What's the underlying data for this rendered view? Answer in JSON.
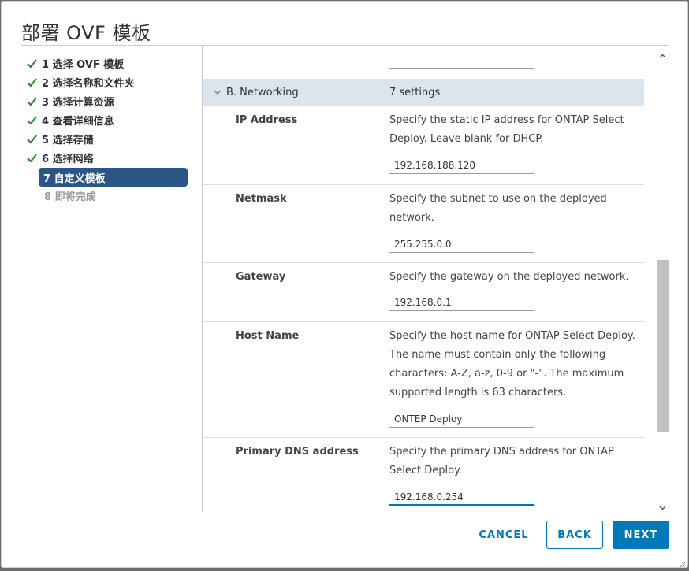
{
  "dialog": {
    "title": "部署 OVF 模板"
  },
  "steps": [
    {
      "label": "1 选择 OVF 模板",
      "state": "done"
    },
    {
      "label": "2 选择名称和文件夹",
      "state": "done"
    },
    {
      "label": "3 选择计算资源",
      "state": "done"
    },
    {
      "label": "4 查看详细信息",
      "state": "done"
    },
    {
      "label": "5 选择存储",
      "state": "done"
    },
    {
      "label": "6 选择网络",
      "state": "done"
    },
    {
      "label": "7 自定义模板",
      "state": "active"
    },
    {
      "label": "8 即将完成",
      "state": "pending"
    }
  ],
  "section": {
    "name": "B. Networking",
    "count": "7 settings"
  },
  "settings": [
    {
      "label": "IP Address",
      "desc": "Specify the static IP address for ONTAP Select Deploy. Leave blank for DHCP.",
      "value": "192.168.188.120"
    },
    {
      "label": "Netmask",
      "desc": "Specify the subnet to use on the deployed network.",
      "value": "255.255.0.0"
    },
    {
      "label": "Gateway",
      "desc": "Specify the gateway on the deployed network.",
      "value": "192.168.0.1"
    },
    {
      "label": "Host Name",
      "desc": "Specify the host name for ONTAP Select Deploy. The name must contain only the following characters: A-Z, a-z, 0-9 or \"-\". The maximum supported length is 63 characters.",
      "value": "ONTEP Deploy"
    },
    {
      "label": "Primary DNS address",
      "desc": "Specify the primary DNS address for ONTAP Select Deploy.",
      "value": "192.168.0.254"
    }
  ],
  "buttons": {
    "cancel": "CANCEL",
    "back": "BACK",
    "next": "NEXT"
  },
  "colors": {
    "accent": "#0079b8",
    "active_step": "#2c5587",
    "check": "#2e8b2e",
    "section_bg": "#dde5ec"
  },
  "icons": {
    "step_done": "checkmark-icon",
    "section_toggle": "chevron-down-icon",
    "scroll_up": "chevron-up-icon",
    "scroll_down": "chevron-down-icon"
  }
}
